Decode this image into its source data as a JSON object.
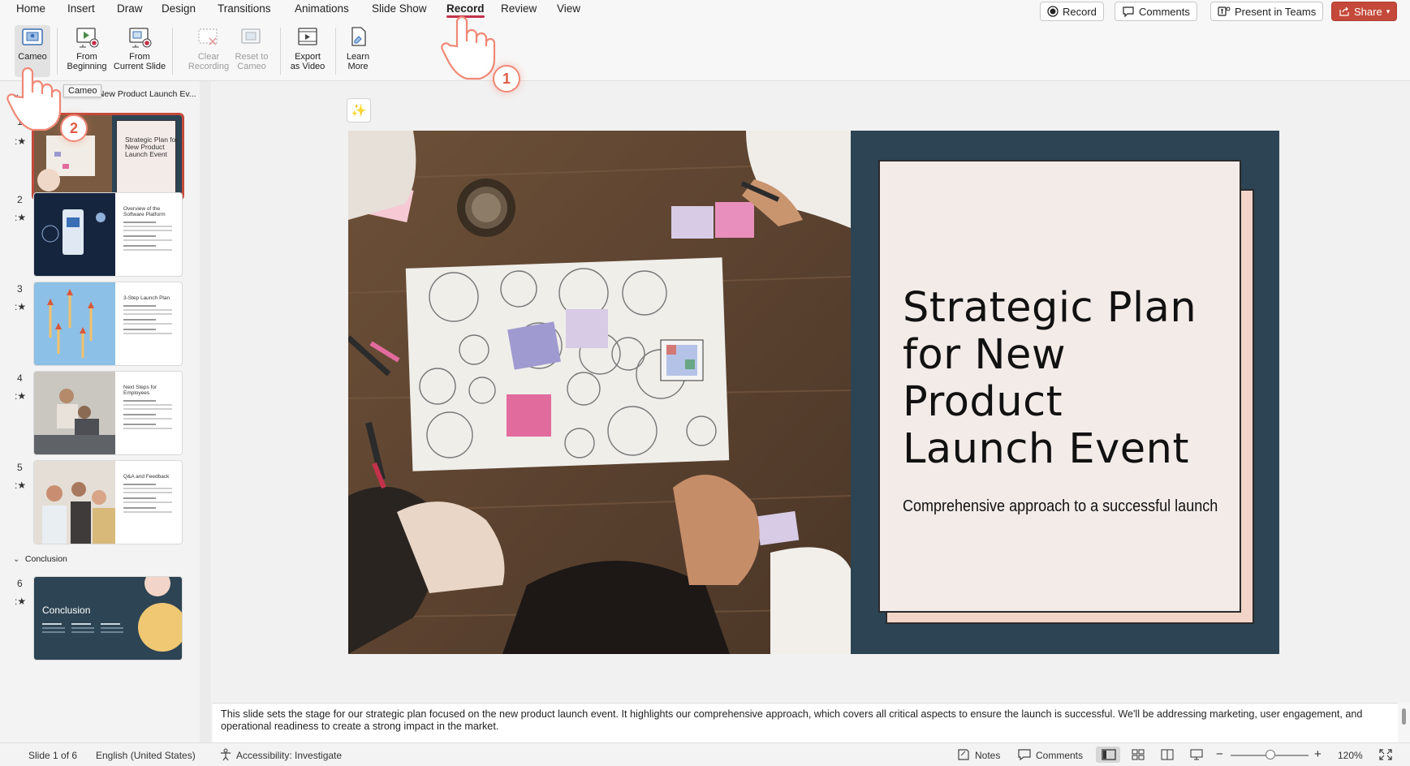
{
  "menu": {
    "items": [
      "Home",
      "Insert",
      "Draw",
      "Design",
      "Transitions",
      "Animations",
      "Slide Show",
      "Record",
      "Review",
      "View"
    ],
    "active": "Record",
    "record_button": "Record",
    "comments_button": "Comments",
    "present_button": "Present in Teams",
    "share_button": "Share"
  },
  "ribbon": {
    "cameo": "Cameo",
    "from_beginning": [
      "From",
      "Beginning"
    ],
    "from_current": [
      "From",
      "Current Slide"
    ],
    "clear_recording": [
      "Clear",
      "Recording"
    ],
    "reset_to_cameo": [
      "Reset to",
      "Cameo"
    ],
    "export_video": [
      "Export",
      "as Video"
    ],
    "learn_more": [
      "Learn",
      "More"
    ]
  },
  "tooltip": "Cameo",
  "sections": [
    {
      "label": "New Product Launch Ev..."
    },
    {
      "label": "Conclusion"
    }
  ],
  "thumbnails": [
    {
      "num": "1",
      "title": "Strategic Plan for New Product Launch Event"
    },
    {
      "num": "2",
      "title": "Overview of the Software Platform"
    },
    {
      "num": "3",
      "title": "3-Step Launch Plan"
    },
    {
      "num": "4",
      "title": "Next Steps for Employees"
    },
    {
      "num": "5",
      "title": "Q&A and Feedback"
    },
    {
      "num": "6",
      "title": "Conclusion"
    }
  ],
  "slide": {
    "title": "Strategic Plan for New Product Launch Event",
    "title_lines": [
      "Strategic Plan",
      "for New",
      "Product",
      "Launch Event"
    ],
    "subtitle": "Comprehensive approach to a successful launch",
    "bg_color": "#2d4454",
    "card_color": "#f3ebe8",
    "card_shadow_color": "#f2d5c8"
  },
  "notes": "This slide sets the stage for our strategic plan focused on the new product launch event. It highlights our comprehensive approach, which covers all critical aspects to ensure the launch is successful. We'll be addressing marketing, user engagement, and operational readiness to create a strong impact in the market.",
  "status": {
    "slide_position": "Slide 1 of 6",
    "language": "English (United States)",
    "accessibility": "Accessibility: Investigate",
    "notes": "Notes",
    "comments": "Comments",
    "zoom": "120%"
  },
  "zoom_slider_fraction": 0.45,
  "annotations": {
    "step1": "1",
    "step2": "2"
  },
  "colors": {
    "accent": "#c4314b",
    "share": "#c4493a",
    "badge": "#f08876"
  }
}
